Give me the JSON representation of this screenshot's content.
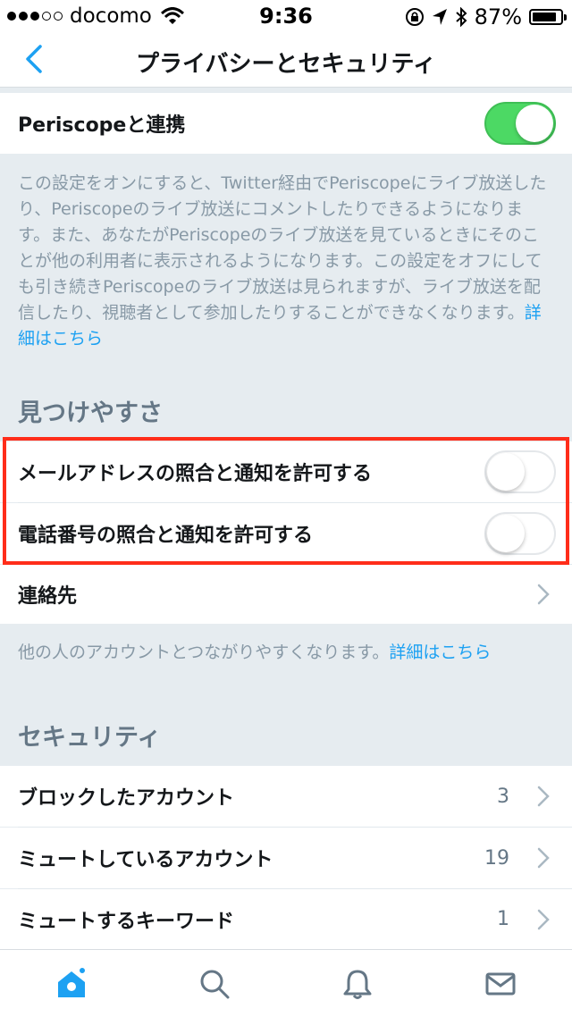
{
  "status_bar": {
    "carrier": "docomo",
    "time": "9:36",
    "battery": "87%",
    "battery_level": 0.87
  },
  "nav": {
    "title": "プライバシーとセキュリティ"
  },
  "periscope": {
    "label": "Periscopeと連携",
    "toggle_on": true,
    "description": "この設定をオンにすると、Twitter経由でPeriscopeにライブ放送したり、Periscopeのライブ放送にコメントしたりできるようになります。また、あなたがPeriscopeのライブ放送を見ているときにそのことが他の利用者に表示されるようになります。この設定をオフにしても引き続きPeriscopeのライブ放送は見られますが、ライブ放送を配信したり、視聴者として参加したりすることができなくなります。",
    "link": "詳細はこちら"
  },
  "discoverability": {
    "header": "見つけやすさ",
    "email_label": "メールアドレスの照合と通知を許可する",
    "email_toggle_on": false,
    "phone_label": "電話番号の照合と通知を許可する",
    "phone_toggle_on": false,
    "contacts_label": "連絡先",
    "description": "他の人のアカウントとつながりやすくなります。",
    "link": "詳細はこちら"
  },
  "security": {
    "header": "セキュリティ",
    "items": [
      {
        "label": "ブロックしたアカウント",
        "value": "3"
      },
      {
        "label": "ミュートしているアカウント",
        "value": "19"
      },
      {
        "label": "ミュートするキーワード",
        "value": "1"
      }
    ]
  },
  "colors": {
    "accent": "#1da1f2",
    "toggle_on": "#4cd964",
    "highlight": "#ff2d1a"
  },
  "tabs": [
    {
      "icon": "home-icon"
    },
    {
      "icon": "search-icon"
    },
    {
      "icon": "bell-icon"
    },
    {
      "icon": "mail-icon"
    }
  ]
}
